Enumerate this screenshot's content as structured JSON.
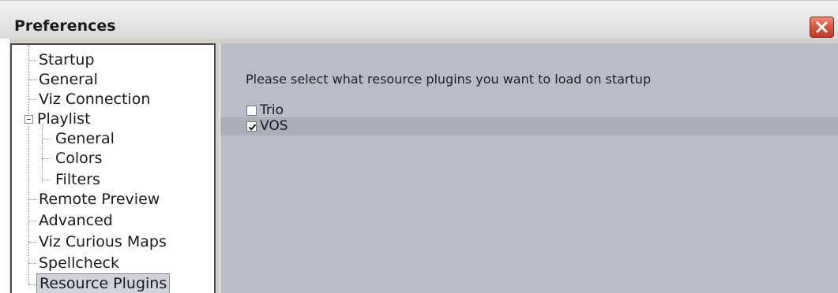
{
  "window": {
    "title": "Preferences"
  },
  "tree": {
    "items": [
      {
        "label": "Startup"
      },
      {
        "label": "General"
      },
      {
        "label": "Viz Connection"
      },
      {
        "label": "Playlist"
      },
      {
        "label": "General"
      },
      {
        "label": "Colors"
      },
      {
        "label": "Filters"
      },
      {
        "label": "Remote Preview"
      },
      {
        "label": "Advanced"
      },
      {
        "label": "Viz Curious Maps"
      },
      {
        "label": "Spellcheck"
      },
      {
        "label": "Resource Plugins"
      }
    ],
    "selected": "Resource Plugins",
    "expanded": "Playlist"
  },
  "content": {
    "prompt": "Please select what resource plugins you want to load on startup",
    "plugins": [
      {
        "label": "Trio",
        "checked": false
      },
      {
        "label": "VOS",
        "checked": true
      }
    ]
  },
  "icons": {
    "close": "close-icon",
    "checkmark": "checkmark-icon",
    "collapse": "collapse-icon"
  },
  "colors": {
    "content_bg": "#b9bdc9",
    "close_button": "#d9543f",
    "selection": "#cfd3dc"
  }
}
